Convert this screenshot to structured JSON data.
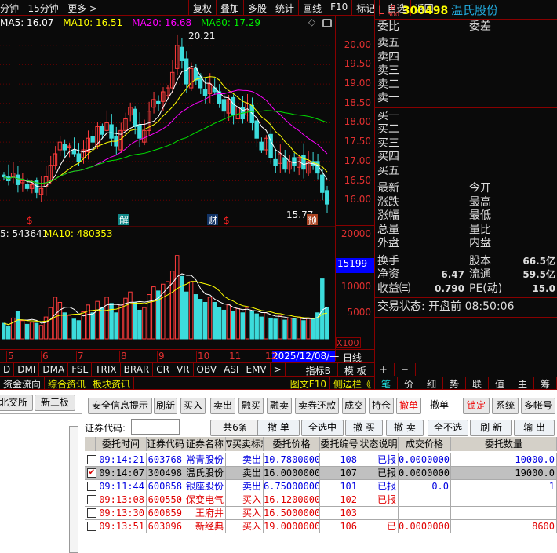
{
  "toolbar": {
    "period1": "分钟",
    "period2": "15分钟",
    "more": "更多 >",
    "buttons": [
      "复权",
      "叠加",
      "多股",
      "统计",
      "画线",
      "F10",
      "标记",
      "-自选",
      "返回"
    ]
  },
  "ma": {
    "ma5": "MA5: 16.07",
    "ma10": "MA10: 16.51",
    "ma20": "MA20: 16.68",
    "ma60": "MA60: 17.29"
  },
  "chart_labels": {
    "high": "20.21",
    "low": "15.77",
    "vol_ma5": "5: 543641",
    "vol_ma10": "MA10: 480353",
    "vol_cursor": "15199",
    "vol_unit": "X100",
    "date_cursor": "2025/12/08/—",
    "period": "日线",
    "marks": [
      "$",
      "解",
      "财",
      "$",
      "预"
    ]
  },
  "chart_data": {
    "type": "candlestick",
    "price_ticks": [
      "20.00",
      "19.50",
      "19.00",
      "18.50",
      "18.00",
      "17.50",
      "17.00",
      "16.50",
      "16.00"
    ],
    "ylim": [
      15.7,
      20.4
    ],
    "vol_ticks": [
      "20000",
      "10000",
      "5000"
    ],
    "month_ticks": [
      "5",
      "6",
      "7",
      "8",
      "9",
      "10",
      "11",
      "12"
    ],
    "close": [
      16.6,
      16.5,
      16.7,
      16.4,
      16.5,
      16.3,
      16.4,
      16.2,
      16.3,
      16.6,
      16.9,
      17.2,
      17.5,
      17.3,
      17.4,
      17.2,
      17.0,
      17.3,
      17.6,
      17.5,
      17.9,
      17.7,
      18.0,
      17.6,
      17.4,
      17.8,
      18.1,
      18.4,
      17.9,
      17.6,
      17.8,
      18.3,
      18.6,
      18.5,
      18.8,
      18.9,
      19.3,
      20.0,
      19.6,
      19.0,
      19.4,
      19.1,
      18.9,
      18.7,
      19.0,
      18.8,
      18.5,
      18.3,
      18.6,
      18.2,
      18.4,
      18.1,
      18.5,
      18.0,
      17.6,
      17.3,
      17.6,
      17.1,
      16.9,
      17.2,
      16.8,
      17.0,
      16.9,
      17.1,
      16.8,
      17.0,
      16.9,
      16.7,
      16.2,
      15.9
    ],
    "volume": [
      3000,
      2500,
      4000,
      5200,
      3500,
      2800,
      3200,
      3000,
      2600,
      4200,
      6000,
      8000,
      7000,
      5000,
      4500,
      3800,
      3500,
      5200,
      6500,
      5000,
      7200,
      6000,
      8000,
      6800,
      5000,
      6500,
      7800,
      9000,
      7000,
      5500,
      6000,
      8500,
      10000,
      9200,
      10500,
      11000,
      13000,
      16000,
      12000,
      9000,
      11000,
      8500,
      7600,
      7000,
      8000,
      7000,
      6000,
      5500,
      6500,
      5200,
      5800,
      5000,
      6000,
      5200,
      4800,
      4200,
      5000,
      4000,
      3800,
      4500,
      3600,
      4000,
      3800,
      4200,
      3500,
      4000,
      3800,
      5000,
      11500,
      6000
    ],
    "ma_colors": {
      "ma5": "#ffffff",
      "ma10": "#ffff00",
      "ma20": "#ff00ff",
      "ma60": "#00e000"
    }
  },
  "quote": {
    "flag_l": "L",
    "flag_r": "R",
    "flag_300": "300",
    "code": "300498",
    "name": "温氏股份",
    "wb": "委比",
    "wc": "委差",
    "sells": [
      "卖五",
      "卖四",
      "卖三",
      "卖二",
      "卖一"
    ],
    "buys": [
      "买一",
      "买二",
      "买三",
      "买四",
      "买五"
    ],
    "stats": [
      [
        "最新",
        "今开"
      ],
      [
        "涨跌",
        "最高"
      ],
      [
        "涨幅",
        "最低"
      ],
      [
        "总量",
        "量比"
      ],
      [
        "外盘",
        "内盘"
      ]
    ],
    "fund": [
      {
        "a": "换手",
        "av": "",
        "b": "股本",
        "bv": "66.5亿"
      },
      {
        "a": "净资",
        "av": "6.47",
        "b": "流通",
        "bv": "59.5亿"
      },
      {
        "a": "收益㈢",
        "av": "0.790",
        "b": "PE(动)",
        "bv": "15.0"
      }
    ],
    "status": "交易状态: 开盘前 08:50:06"
  },
  "indicators": [
    "D",
    "DMI",
    "DMA",
    "FSL",
    "TRIX",
    "BRAR",
    "CR",
    "VR",
    "OBV",
    "ASI",
    "EMV",
    ">",
    "指标B",
    "模 板",
    "+",
    "−"
  ],
  "info_tabs": [
    "资金流向",
    "综合资讯",
    "板块资讯",
    "图文F10",
    "侧边栏《"
  ],
  "side_tabs": [
    "笔",
    "价",
    "细",
    "势",
    "联",
    "值",
    "主",
    "筹"
  ],
  "left_tabs": [
    "北交所",
    "新三板"
  ],
  "trade": {
    "top_buttons": [
      "安全信息提示",
      "刷新",
      "买入",
      "卖出",
      "融买",
      "融卖",
      "卖券还款",
      "成交",
      "持仓",
      "撤单",
      "撤单",
      "锁定",
      "系统",
      "多帐号"
    ],
    "code_label": "证券代码:",
    "code_value": "",
    "count": "共6条",
    "action_buttons": [
      "撤 单",
      "全选中",
      "撤 买",
      "撤 卖",
      "全不选",
      "刷 新",
      "输 出"
    ],
    "columns": [
      "委托时间",
      "证券代码",
      "证券名称",
      "∇买卖标志",
      "委托价格",
      "委托编号",
      "状态说明",
      "成交价格",
      "委托数量"
    ],
    "rows": [
      {
        "checked": false,
        "color": "#0000e0",
        "cells": [
          "09:14:21",
          "603768",
          "常青股份",
          "卖出",
          "10.78000000",
          "108",
          "已报",
          "0.00000000",
          "10000.0"
        ]
      },
      {
        "checked": true,
        "color": "#000000",
        "cells": [
          "09:14:07",
          "300498",
          "温氏股份",
          "卖出",
          "16.00000000",
          "107",
          "已报",
          "0.00000000",
          "19000.0"
        ]
      },
      {
        "checked": false,
        "color": "#0000e0",
        "cells": [
          "09:11:44",
          "600858",
          "银座股份",
          "卖出",
          "6.75000000",
          "101",
          "已报",
          "0.0",
          "1"
        ]
      },
      {
        "checked": false,
        "color": "#e00000",
        "cells": [
          "09:13:08",
          "600550",
          "保变电气",
          "买入",
          "16.12000000",
          "102",
          "已报",
          "",
          ""
        ]
      },
      {
        "checked": false,
        "color": "#e00000",
        "cells": [
          "09:13:30",
          "600859",
          "王府井",
          "买入",
          "16.50000000",
          "103",
          "",
          "",
          ""
        ]
      },
      {
        "checked": false,
        "color": "#e00000",
        "cells": [
          "09:13:51",
          "603096",
          "新经典",
          "买入",
          "19.00000000",
          "106",
          "已",
          "0.00000000",
          "8600"
        ]
      }
    ]
  }
}
